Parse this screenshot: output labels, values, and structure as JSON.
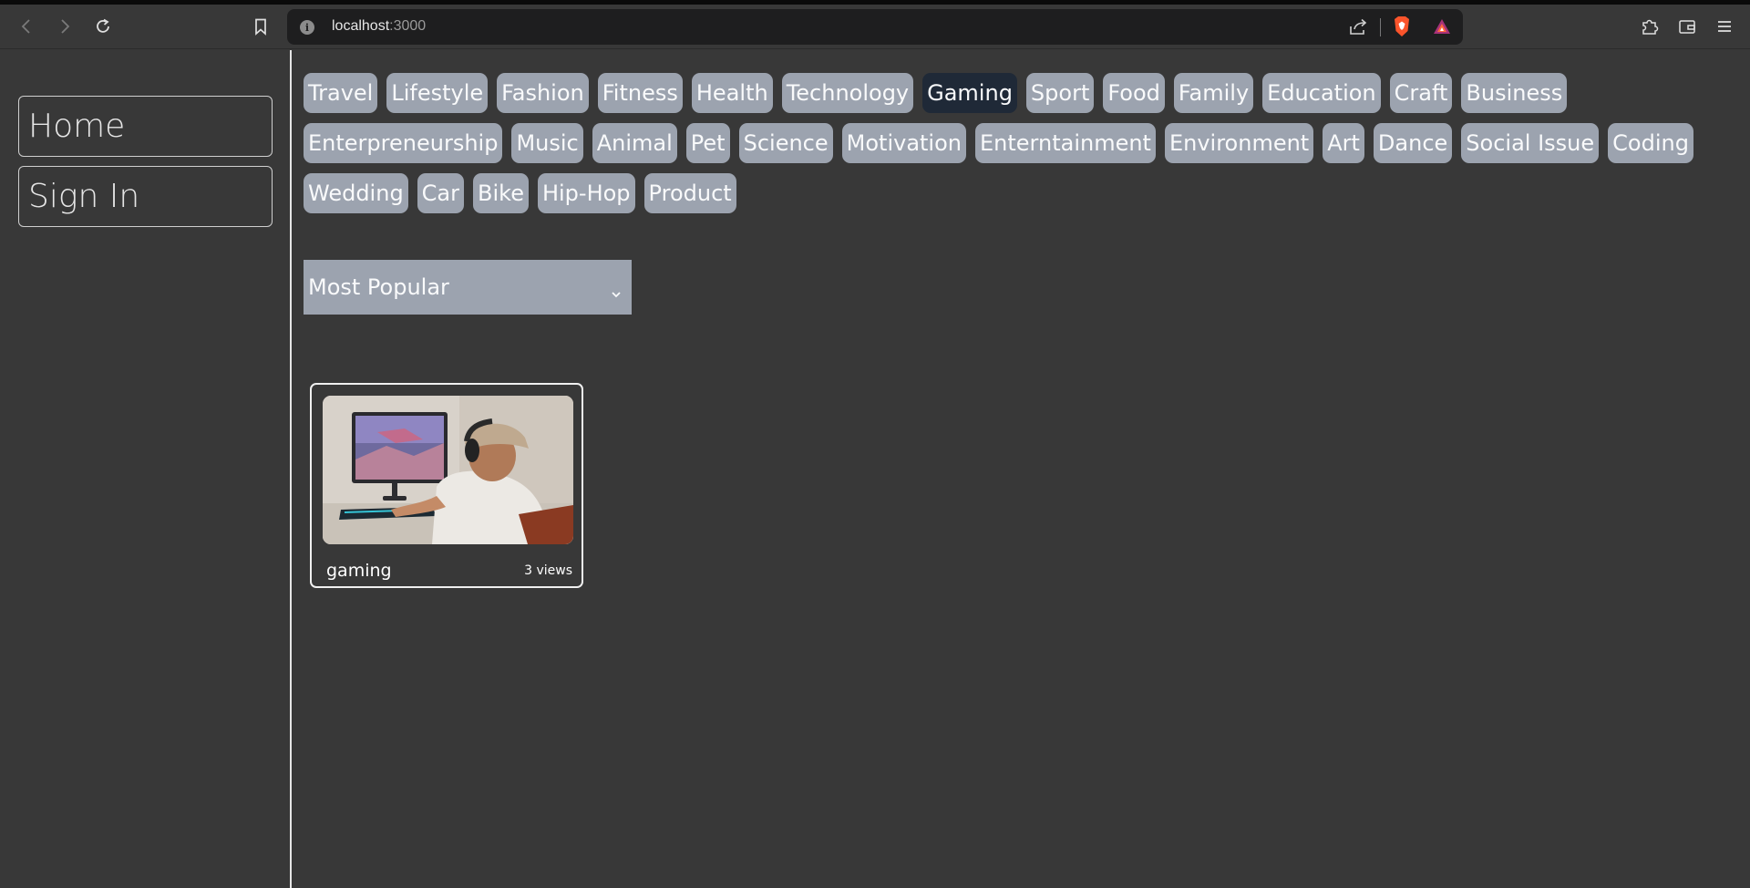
{
  "browser": {
    "url_host": "localhost",
    "url_port": ":3000",
    "icons": [
      "back-icon",
      "forward-icon",
      "reload-icon",
      "bookmark-icon",
      "info-icon",
      "share-icon",
      "brave-shields-icon",
      "brave-rewards-icon",
      "extensions-icon",
      "wallet-icon",
      "menu-icon"
    ]
  },
  "sidebar": {
    "items": [
      {
        "label": "Home"
      },
      {
        "label": "Sign In"
      }
    ]
  },
  "categories": [
    "Travel",
    "Lifestyle",
    "Fashion",
    "Fitness",
    "Health",
    "Technology",
    "Gaming",
    "Sport",
    "Food",
    "Family",
    "Education",
    "Craft",
    "Business",
    "Enterpreneurship",
    "Music",
    "Animal",
    "Pet",
    "Science",
    "Motivation",
    "Enterntainment",
    "Environment",
    "Art",
    "Dance",
    "Social Issue",
    "Coding",
    "Wedding",
    "Car",
    "Bike",
    "Hip-Hop",
    "Product"
  ],
  "active_category": "Gaming",
  "sort": {
    "selected": "Most Popular"
  },
  "posts": [
    {
      "title": "gaming",
      "views": "3 views",
      "image": "man with headset playing video game at desktop monitor"
    }
  ],
  "colors": {
    "background": "#383838",
    "tag": "#9ca3af",
    "tag_active": "#1f2937",
    "text": "#f9fafb"
  }
}
